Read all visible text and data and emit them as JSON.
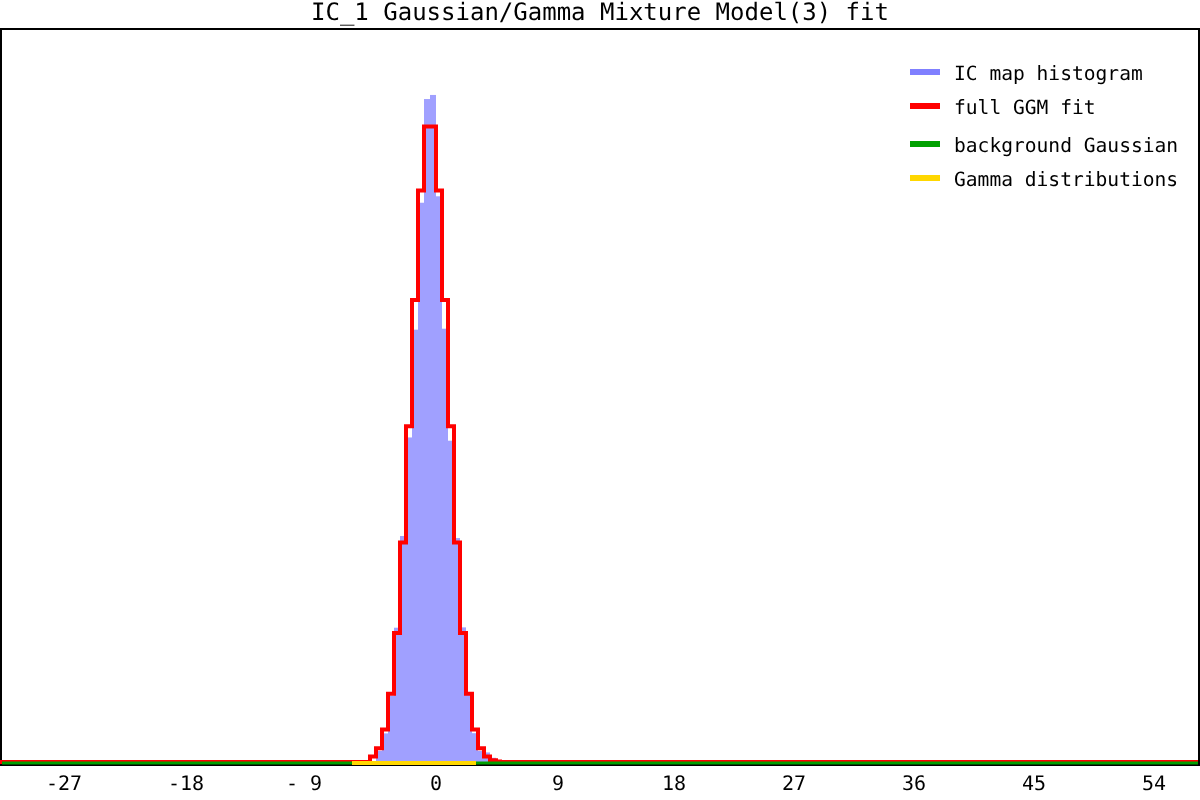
{
  "title": "IC_1 Gaussian/Gamma Mixture Model(3) fit",
  "legend": [
    {
      "label": "IC map histogram",
      "color": "#8080ff"
    },
    {
      "label": "full GGM fit",
      "color": "#ff0000"
    },
    {
      "label": "background Gaussian",
      "color": "#00a000"
    },
    {
      "label": "Gamma distributions",
      "color": "#ffd700"
    }
  ],
  "x_tick_labels": [
    "-27",
    "-18",
    "- 9",
    "0",
    "9",
    "18",
    "27",
    "36",
    "45",
    "54"
  ]
}
